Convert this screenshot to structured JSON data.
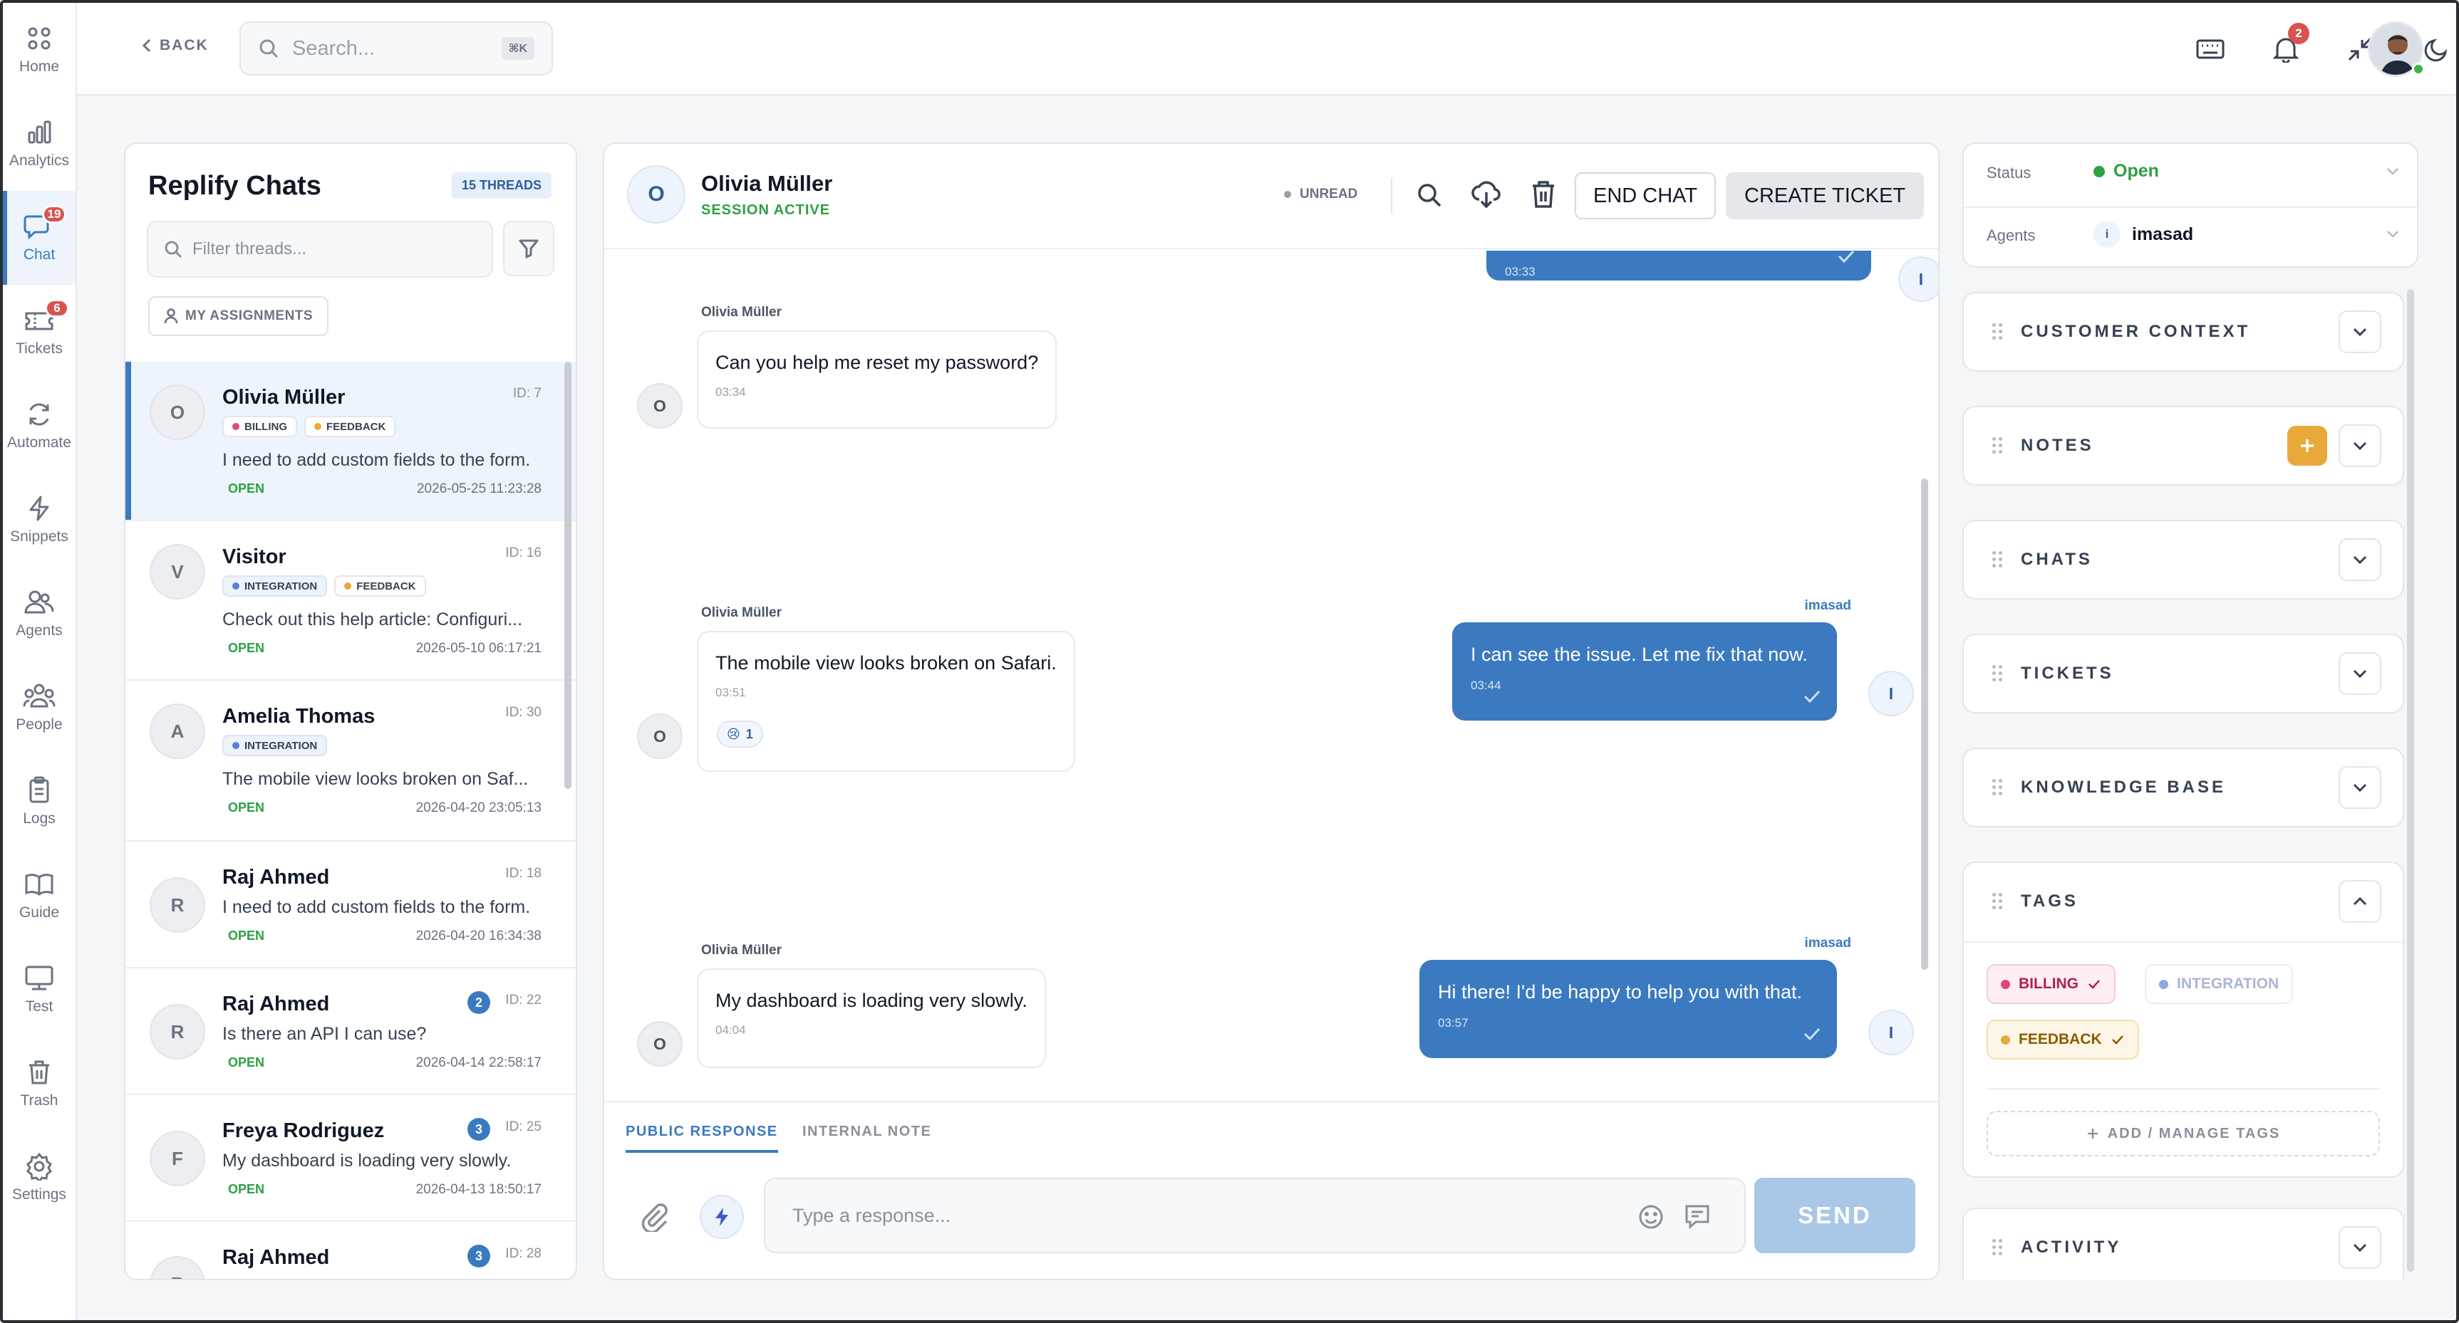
{
  "nav": {
    "items": [
      {
        "label": "Home",
        "icon": "home-icon"
      },
      {
        "label": "Analytics",
        "icon": "analytics-icon"
      },
      {
        "label": "Chat",
        "icon": "chat-icon",
        "badge": "19",
        "active": true
      },
      {
        "label": "Tickets",
        "icon": "tickets-icon",
        "badge": "6"
      },
      {
        "label": "Automate",
        "icon": "automate-icon"
      },
      {
        "label": "Snippets",
        "icon": "snippets-icon"
      },
      {
        "label": "Agents",
        "icon": "agents-icon"
      },
      {
        "label": "People",
        "icon": "people-icon"
      },
      {
        "label": "Logs",
        "icon": "logs-icon"
      },
      {
        "label": "Guide",
        "icon": "guide-icon"
      },
      {
        "label": "Test",
        "icon": "test-icon"
      },
      {
        "label": "Trash",
        "icon": "trash-icon"
      },
      {
        "label": "Settings",
        "icon": "settings-icon"
      }
    ]
  },
  "topbar": {
    "back_label": "BACK",
    "search_placeholder": "Search...",
    "search_shortcut": "⌘K",
    "notification_count": "2"
  },
  "threads_panel": {
    "title": "Replify Chats",
    "count_badge": "15 THREADS",
    "filter_placeholder": "Filter threads...",
    "assignments_label": "MY ASSIGNMENTS",
    "threads": [
      {
        "initial": "O",
        "name": "Olivia Müller",
        "id": "ID: 7",
        "tags": [
          {
            "label": "BILLING",
            "color": "#e0457b"
          },
          {
            "label": "FEEDBACK",
            "color": "#e8a93a"
          }
        ],
        "message": "I need to add custom fields to the form.",
        "status": "OPEN",
        "date": "2026-05-25 11:23:28",
        "selected": true
      },
      {
        "initial": "V",
        "name": "Visitor",
        "id": "ID: 16",
        "tags": [
          {
            "label": "INTEGRATION",
            "color": "#5b7fd6"
          },
          {
            "label": "FEEDBACK",
            "color": "#e8a93a"
          }
        ],
        "message": "Check out this help article: Configuri...",
        "status": "OPEN",
        "date": "2026-05-10 06:17:21"
      },
      {
        "initial": "A",
        "name": "Amelia Thomas",
        "id": "ID: 30",
        "tags": [
          {
            "label": "INTEGRATION",
            "color": "#5b7fd6"
          }
        ],
        "message": "The mobile view looks broken on Saf...",
        "status": "OPEN",
        "date": "2026-04-20 23:05:13"
      },
      {
        "initial": "R",
        "name": "Raj Ahmed",
        "id": "ID: 18",
        "tags": [],
        "message": "I need to add custom fields to the form.",
        "status": "OPEN",
        "date": "2026-04-20 16:34:38"
      },
      {
        "initial": "R",
        "name": "Raj Ahmed",
        "id": "ID: 22",
        "count": "2",
        "tags": [],
        "message": "Is there an API I can use?",
        "status": "OPEN",
        "date": "2026-04-14 22:58:17"
      },
      {
        "initial": "F",
        "name": "Freya Rodriguez",
        "id": "ID: 25",
        "count": "3",
        "tags": [],
        "message": "My dashboard is loading very slowly.",
        "status": "OPEN",
        "date": "2026-04-13 18:50:17"
      },
      {
        "initial": "R",
        "name": "Raj Ahmed",
        "id": "ID: 28",
        "count": "3",
        "tags": [],
        "message": "",
        "status": "",
        "date": ""
      }
    ]
  },
  "chat": {
    "contact_initial": "O",
    "contact_name": "Olivia Müller",
    "session_status": "SESSION ACTIVE",
    "unread_label": "UNREAD",
    "end_chat_label": "END CHAT",
    "create_ticket_label": "CREATE TICKET",
    "messages": [
      {
        "dir": "out",
        "sender": "",
        "text": "",
        "time": "03:33",
        "avatar": "I"
      },
      {
        "dir": "in",
        "sender": "Olivia Müller",
        "text": "Can you help me reset my password?",
        "time": "03:34",
        "avatar": "O"
      },
      {
        "dir": "out",
        "sender": "imasad",
        "text": "I can see the issue. Let me fix that now.",
        "time": "03:44",
        "avatar": "I"
      },
      {
        "dir": "in",
        "sender": "Olivia Müller",
        "text": "The mobile view looks broken on Safari.",
        "time": "03:51",
        "avatar": "O",
        "reaction": "😢",
        "reaction_count": "1"
      },
      {
        "dir": "out",
        "sender": "imasad",
        "text": "Hi there! I'd be happy to help you with that.",
        "time": "03:57",
        "avatar": "I"
      },
      {
        "dir": "in",
        "sender": "Olivia Müller",
        "text": "My dashboard is loading very slowly.",
        "time": "04:04",
        "avatar": "O"
      }
    ],
    "tabs": [
      "PUBLIC RESPONSE",
      "INTERNAL NOTE"
    ],
    "input_placeholder": "Type a response...",
    "send_label": "SEND"
  },
  "details": {
    "status_label": "Status",
    "status_value": "Open",
    "agents_label": "Agents",
    "agent_initial": "i",
    "agent_value": "imasad",
    "sections": [
      "CUSTOMER CONTEXT",
      "NOTES",
      "CHATS",
      "TICKETS",
      "KNOWLEDGE BASE",
      "TAGS",
      "ACTIVITY"
    ],
    "tags": [
      {
        "label": "BILLING",
        "color": "#e0457b",
        "active": true
      },
      {
        "label": "INTEGRATION",
        "color": "#8fa6e3",
        "active": false
      },
      {
        "label": "FEEDBACK",
        "color": "#e8a93a",
        "active": true
      }
    ],
    "manage_tags_label": "ADD / MANAGE TAGS"
  },
  "colors": {
    "accent": "#3b7ac0",
    "open": "#2ea043",
    "badge": "#d9534f",
    "notes_add": "#e8a93a"
  }
}
